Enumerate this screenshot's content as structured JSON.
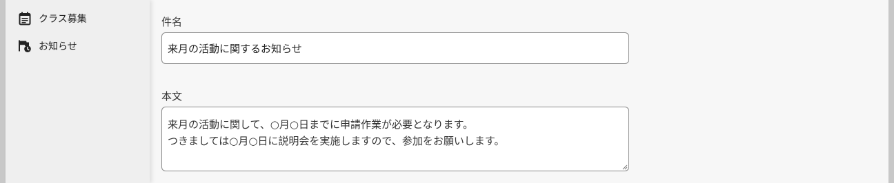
{
  "sidebar": {
    "items": [
      {
        "label": "クラス募集",
        "icon": "calendar-list-icon"
      },
      {
        "label": "お知らせ",
        "icon": "flag-clock-icon"
      }
    ]
  },
  "form": {
    "subject_label": "件名",
    "subject_value": "来月の活動に関するお知らせ",
    "body_label": "本文",
    "body_value": "来月の活動に関して、○月○日までに申請作業が必要となります。\nつきましては○月○日に説明会を実施しますので、参加をお願いします。"
  }
}
